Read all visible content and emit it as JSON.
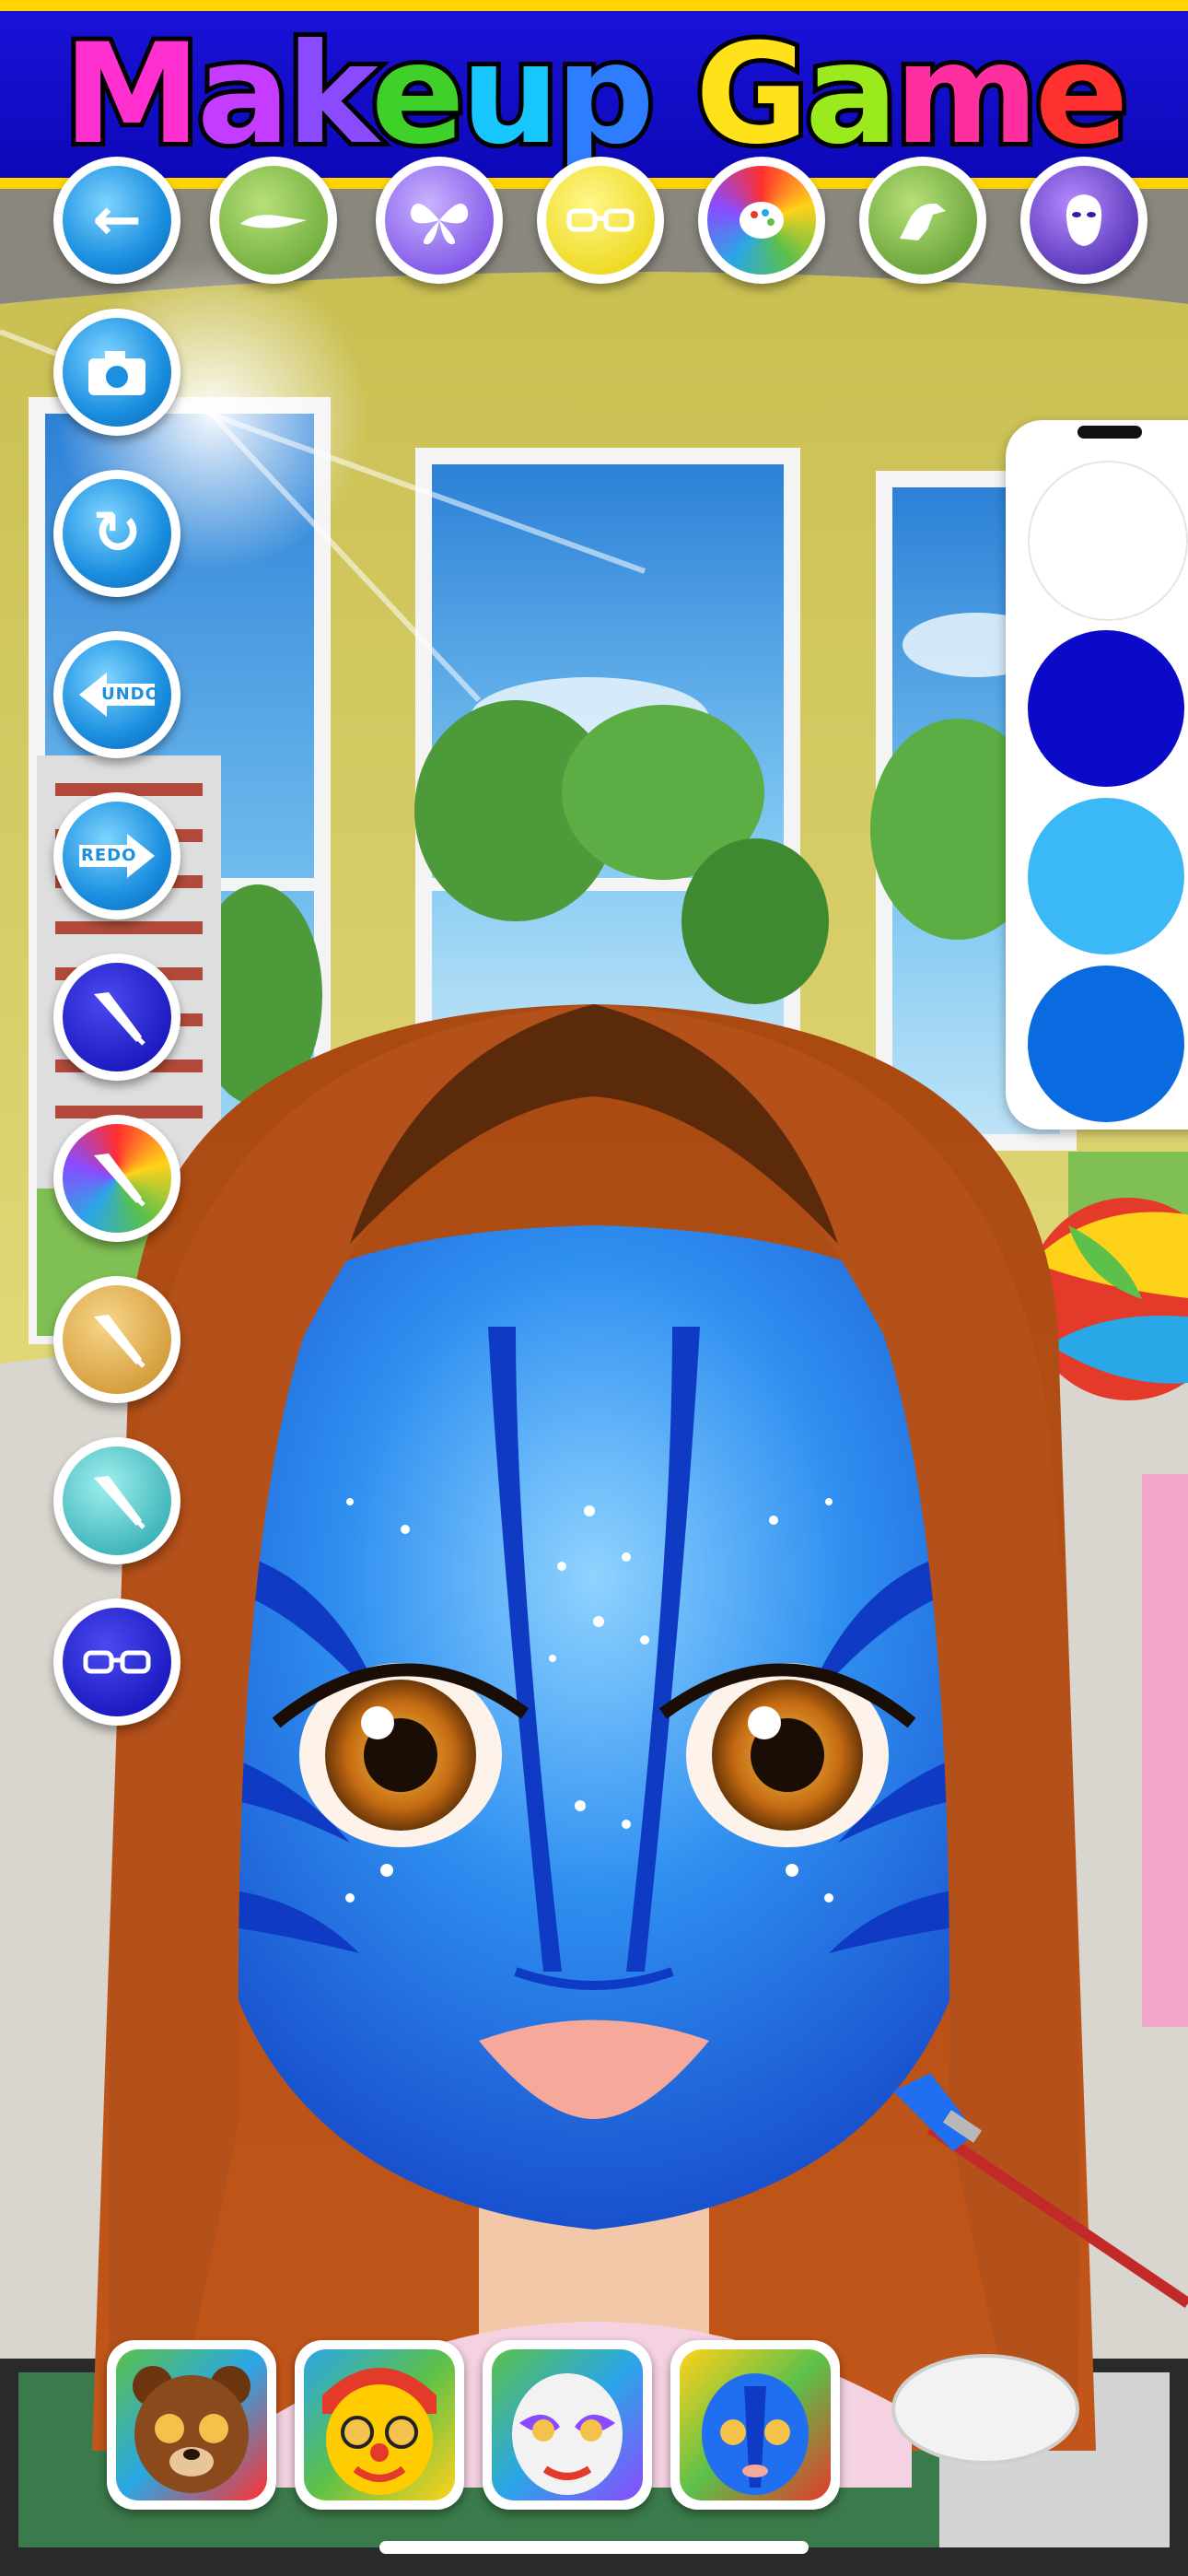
{
  "header": {
    "title_letters": [
      {
        "ch": "M",
        "color": "#ff2fd0"
      },
      {
        "ch": "a",
        "color": "#c43cff"
      },
      {
        "ch": "k",
        "color": "#8a4bff"
      },
      {
        "ch": "e",
        "color": "#3fd02a"
      },
      {
        "ch": "u",
        "color": "#19c7ff"
      },
      {
        "ch": "p",
        "color": "#2f7dff"
      },
      {
        "ch": " ",
        "color": "#ffffff"
      },
      {
        "ch": "G",
        "color": "#ffe21a"
      },
      {
        "ch": "a",
        "color": "#9bea1e"
      },
      {
        "ch": "m",
        "color": "#ff2fa0"
      },
      {
        "ch": "e",
        "color": "#ff3030"
      }
    ]
  },
  "top_toolbar": [
    {
      "name": "back-button",
      "icon": "left-arrow-icon"
    },
    {
      "name": "category-crocodile-button",
      "icon": "crocodile-icon"
    },
    {
      "name": "category-butterfly-button",
      "icon": "butterfly-icon"
    },
    {
      "name": "category-glasses-button",
      "icon": "glasses-icon"
    },
    {
      "name": "category-paint-palette-button",
      "icon": "paint-palette-icon"
    },
    {
      "name": "category-dinosaur-button",
      "icon": "dinosaur-icon"
    },
    {
      "name": "category-mask-button",
      "icon": "mask-icon"
    }
  ],
  "side_toolbar": [
    {
      "name": "camera-button",
      "icon": "camera-icon",
      "label": ""
    },
    {
      "name": "reset-button",
      "icon": "refresh-icon",
      "label": ""
    },
    {
      "name": "undo-button",
      "icon": "undo-arrow-icon",
      "label": "UNDO"
    },
    {
      "name": "redo-button",
      "icon": "redo-arrow-icon",
      "label": "REDO"
    },
    {
      "name": "brush-solid-button",
      "icon": "paintbrush-icon",
      "label": ""
    },
    {
      "name": "brush-rainbow-button",
      "icon": "rainbow-brush-icon",
      "label": ""
    },
    {
      "name": "brush-gold-glitter-button",
      "icon": "glitter-brush-icon",
      "label": ""
    },
    {
      "name": "brush-teal-glitter-button",
      "icon": "glitter-brush-icon",
      "label": ""
    },
    {
      "name": "glasses-tool-button",
      "icon": "glasses-icon",
      "label": ""
    }
  ],
  "palette": {
    "colors": [
      "#ffffff",
      "#0a0ac8",
      "#3ab9f6",
      "#0a6be0"
    ]
  },
  "presets": [
    {
      "name": "preset-bear-face",
      "base": "#8a4a1c"
    },
    {
      "name": "preset-clown-face",
      "base": "#ffcc00"
    },
    {
      "name": "preset-white-mask-face",
      "base": "#f2f2f2"
    },
    {
      "name": "preset-blue-avatar-face",
      "base": "#1f6ff0"
    }
  ]
}
